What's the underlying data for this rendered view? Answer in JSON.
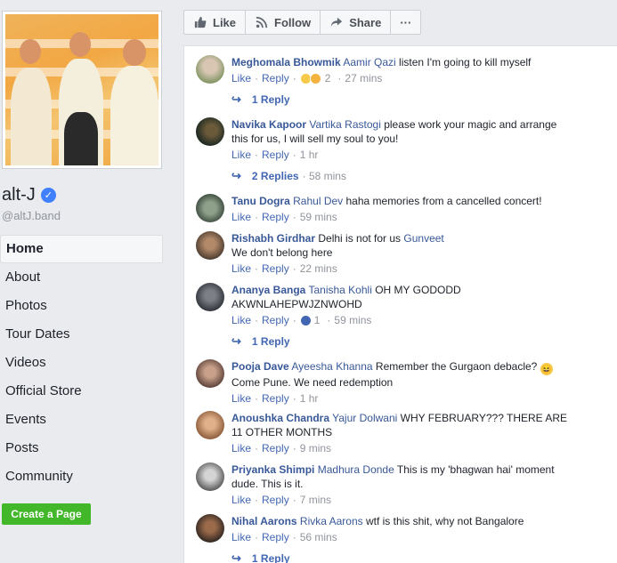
{
  "sidebar": {
    "page_name": "alt-J",
    "handle": "@altJ.band",
    "nav": [
      {
        "label": "Home",
        "active": true
      },
      {
        "label": "About"
      },
      {
        "label": "Photos"
      },
      {
        "label": "Tour Dates"
      },
      {
        "label": "Videos"
      },
      {
        "label": "Official Store"
      },
      {
        "label": "Events"
      },
      {
        "label": "Posts"
      },
      {
        "label": "Community"
      }
    ],
    "create_page_label": "Create a Page"
  },
  "actions": {
    "like_label": "Like",
    "follow_label": "Follow",
    "share_label": "Share",
    "more_label": "···"
  },
  "labels": {
    "like": "Like",
    "reply": "Reply"
  },
  "comments": [
    {
      "author": "Meghomala Bhowmik",
      "mention": "Aamir Qazi",
      "text": " listen I'm going to kill myself",
      "reactions": "2",
      "age": "27 mins",
      "replies": "1 Reply"
    },
    {
      "author": "Navika Kapoor",
      "mention": "Vartika Rastogi",
      "text": " please work your magic and arrange this for us, I will sell my soul to you!",
      "age": "1 hr",
      "replies": "2 Replies",
      "replies_age": "58 mins"
    },
    {
      "author": "Tanu Dogra",
      "mention": "Rahul Dev",
      "text": " haha memories from a cancelled concert!",
      "age": "59 mins"
    },
    {
      "author": "Rishabh Girdhar",
      "text": " Delhi is not for us ",
      "mention_after": "Gunveet",
      "text2": "We don't belong here",
      "age": "22 mins"
    },
    {
      "author": "Ananya Banga",
      "mention": "Tanisha Kohli",
      "text": " OH MY GODODD AKWNLAHEPWJZNWOHD",
      "reactions": "1",
      "age": "59 mins",
      "replies": "1 Reply"
    },
    {
      "author": "Pooja Dave",
      "mention": "Ayeesha Khanna",
      "text": " Remember the Gurgaon debacle? ",
      "text2": "Come Pune. We need redemption",
      "age": "1 hr"
    },
    {
      "author": "Anoushka Chandra",
      "mention": "Yajur Dolwani",
      "text": " WHY FEBRUARY??? THERE ARE 11 OTHER MONTHS",
      "age": "9 mins"
    },
    {
      "author": "Priyanka Shimpi",
      "mention": "Madhura Donde",
      "text": " This is my 'bhagwan hai' moment dude. This is it.",
      "age": "7 mins"
    },
    {
      "author": "Nihal Aarons",
      "mention": "Rivka Aarons",
      "text": " wtf is this shit, why not Bangalore",
      "age": "56 mins",
      "replies": "1 Reply"
    }
  ],
  "colors": {
    "link": "#385898",
    "action_link": "#4267b2",
    "meta": "#90949c",
    "green": "#42b72a",
    "verified": "#4080ff"
  }
}
